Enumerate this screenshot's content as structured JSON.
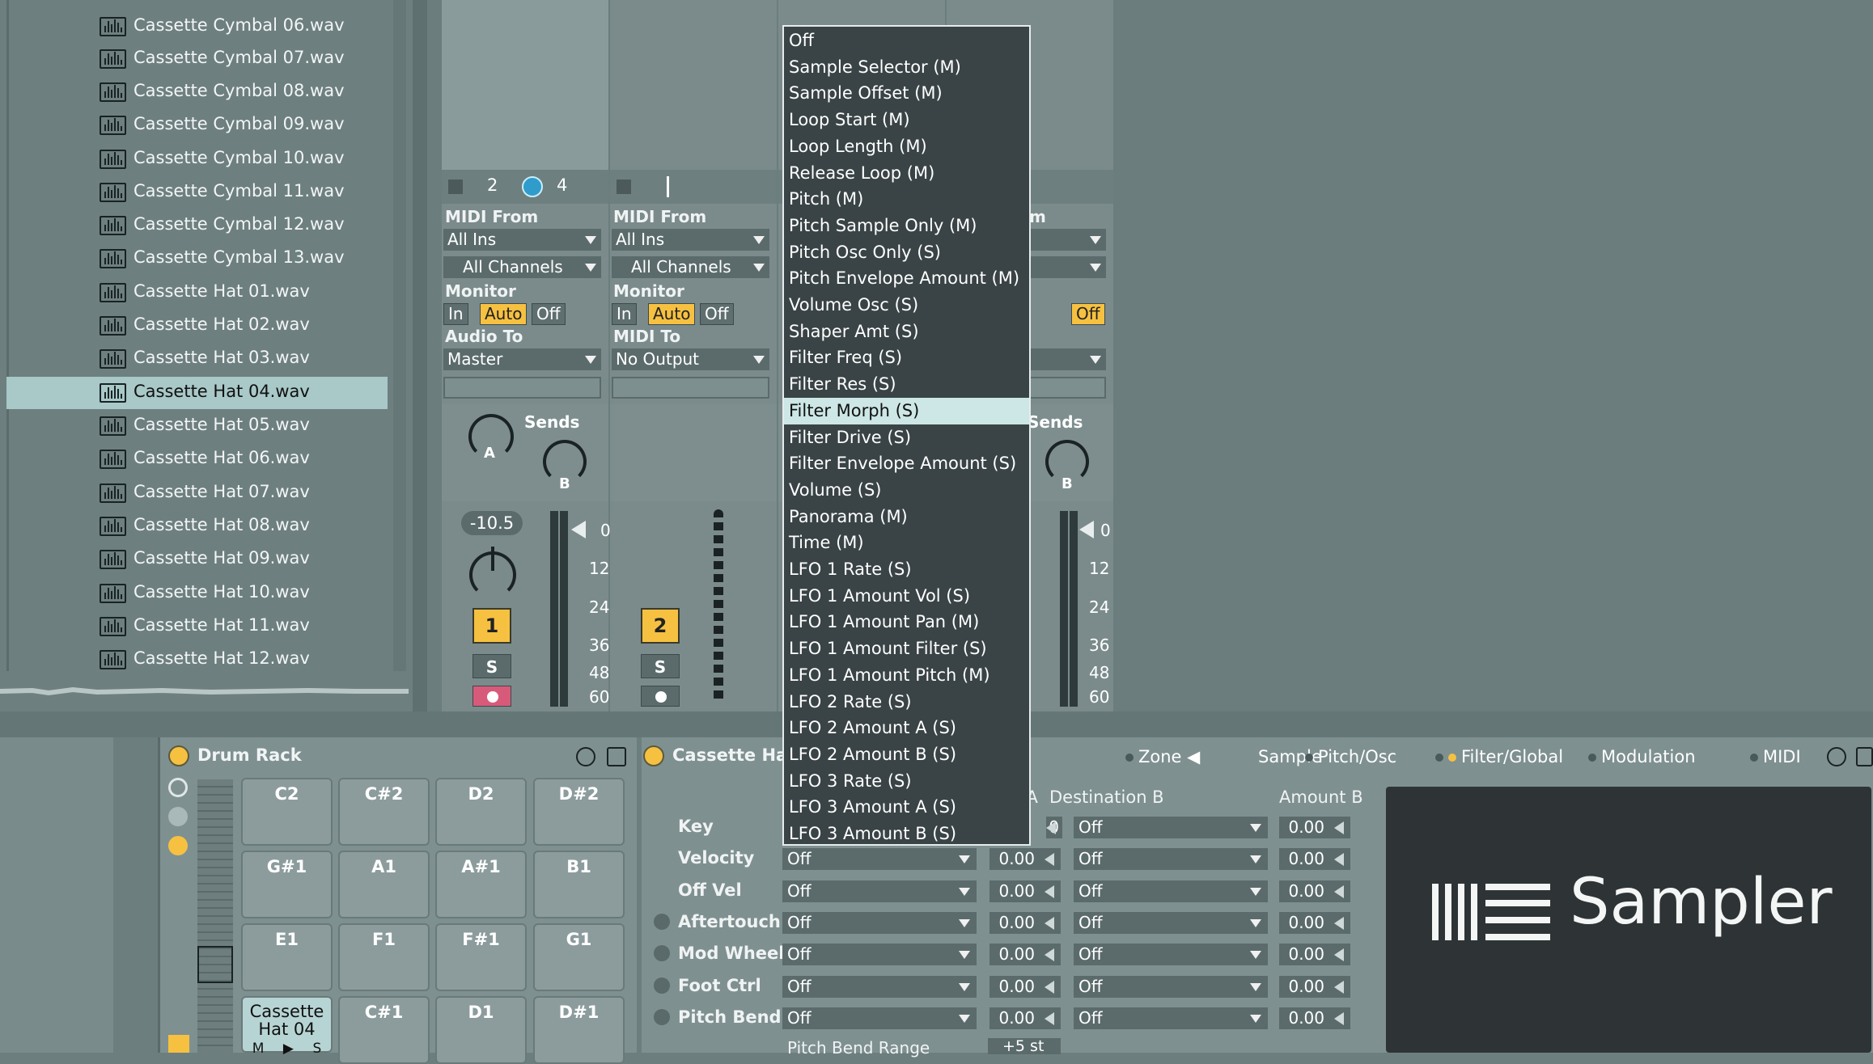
{
  "browser": {
    "files": [
      "Cassette Cymbal 06.wav",
      "Cassette Cymbal 07.wav",
      "Cassette Cymbal 08.wav",
      "Cassette Cymbal 09.wav",
      "Cassette Cymbal 10.wav",
      "Cassette Cymbal 11.wav",
      "Cassette Cymbal 12.wav",
      "Cassette Cymbal 13.wav",
      "Cassette Hat 01.wav",
      "Cassette Hat 02.wav",
      "Cassette Hat 03.wav",
      "Cassette Hat 04.wav",
      "Cassette Hat 05.wav",
      "Cassette Hat 06.wav",
      "Cassette Hat 07.wav",
      "Cassette Hat 08.wav",
      "Cassette Hat 09.wav",
      "Cassette Hat 10.wav",
      "Cassette Hat 11.wav",
      "Cassette Hat 12.wav"
    ],
    "selected_index": 11
  },
  "track1": {
    "quant_left": "2",
    "quant_right": "4",
    "midi_from_label": "MIDI From",
    "midi_from": "All Ins",
    "channel": "All Channels",
    "monitor_label": "Monitor",
    "monitor_in": "In",
    "monitor_auto": "Auto",
    "monitor_off": "Off",
    "audio_to_label": "Audio To",
    "audio_to": "Master",
    "sends_label": "Sends",
    "send_a": "A",
    "send_b": "B",
    "volume": "-10.5",
    "track_number": "1",
    "solo": "S",
    "meter_scale": [
      "0",
      "12",
      "24",
      "36",
      "48",
      "60"
    ]
  },
  "track2": {
    "midi_from_label": "MIDI From",
    "midi_from": "All Ins",
    "channel": "All Channels",
    "monitor_label": "Monitor",
    "monitor_in": "In",
    "monitor_auto": "Auto",
    "monitor_off": "Off",
    "midi_to_label": "MIDI To",
    "midi_to": "No Output",
    "track_number": "2",
    "solo": "S"
  },
  "track3": {
    "midi_from_label_partial": "m",
    "monitor_off": "Off",
    "sends_label": "Sends",
    "send_b": "B",
    "meter_scale": [
      "0",
      "12",
      "24",
      "36",
      "48",
      "60"
    ]
  },
  "drum_rack": {
    "title": "Drum Rack",
    "pads": [
      [
        "C2",
        "C#2",
        "D2",
        "D#2"
      ],
      [
        "G#1",
        "A1",
        "A#1",
        "B1"
      ],
      [
        "E1",
        "F1",
        "F#1",
        "G1"
      ],
      [
        "Cassette Hat 04",
        "C#1",
        "D1",
        "D#1"
      ]
    ],
    "pad_buttons": [
      "M",
      "S"
    ]
  },
  "sampler": {
    "title": "Cassette Hat",
    "tabs": [
      "Zone",
      "Sample",
      "Pitch/Osc",
      "Filter/Global",
      "Modulation",
      "MIDI"
    ],
    "columns": {
      "amount_a": "unt A",
      "dest_b": "Destination B",
      "amount_b": "Amount B"
    },
    "rows": [
      {
        "label": "Key",
        "amount_a": "0",
        "dest_b": "Off",
        "amount_b": "0.00"
      },
      {
        "label": "Velocity",
        "dest_a": "Off",
        "amount_a": "0.00",
        "dest_b": "Off",
        "amount_b": "0.00"
      },
      {
        "label": "Off Vel",
        "dest_a": "Off",
        "amount_a": "0.00",
        "dest_b": "Off",
        "amount_b": "0.00"
      },
      {
        "label": "Aftertouch",
        "dest_a": "Off",
        "amount_a": "0.00",
        "dest_b": "Off",
        "amount_b": "0.00"
      },
      {
        "label": "Mod Wheel",
        "dest_a": "Off",
        "amount_a": "0.00",
        "dest_b": "Off",
        "amount_b": "0.00"
      },
      {
        "label": "Foot Ctrl",
        "dest_a": "Off",
        "amount_a": "0.00",
        "dest_b": "Off",
        "amount_b": "0.00"
      },
      {
        "label": "Pitch Bend",
        "dest_a": "Off",
        "amount_a": "0.00",
        "dest_b": "Off",
        "amount_b": "0.00"
      }
    ],
    "pitch_bend_range_label": "Pitch Bend Range",
    "pitch_bend_range": "+5 st",
    "logo_text": "Sampler"
  },
  "popup_menu": {
    "items": [
      "Off",
      "Sample Selector (M)",
      "Sample Offset (M)",
      "Loop Start (M)",
      "Loop Length (M)",
      "Release Loop (M)",
      "Pitch (M)",
      "Pitch Sample Only (M)",
      "Pitch Osc Only (S)",
      "Pitch Envelope Amount (M)",
      "Volume Osc (S)",
      "Shaper Amt (S)",
      "Filter Freq (S)",
      "Filter Res (S)",
      "Filter Morph (S)",
      "Filter Drive (S)",
      "Filter Envelope Amount (S)",
      "Volume (S)",
      "Panorama (M)",
      "Time (M)",
      "LFO 1 Rate (S)",
      "LFO 1 Amount Vol (S)",
      "LFO 1 Amount Pan (M)",
      "LFO 1 Amount Filter (S)",
      "LFO 1 Amount Pitch (M)",
      "LFO 2 Rate (S)",
      "LFO 2 Amount A (S)",
      "LFO 2 Amount B (S)",
      "LFO 3 Rate (S)",
      "LFO 3 Amount A (S)",
      "LFO 3 Amount B (S)"
    ],
    "highlighted_index": 14
  },
  "colors": {
    "accent": "#f6c141",
    "selection": "#cde6e6",
    "bg": "#6d7e7f"
  }
}
